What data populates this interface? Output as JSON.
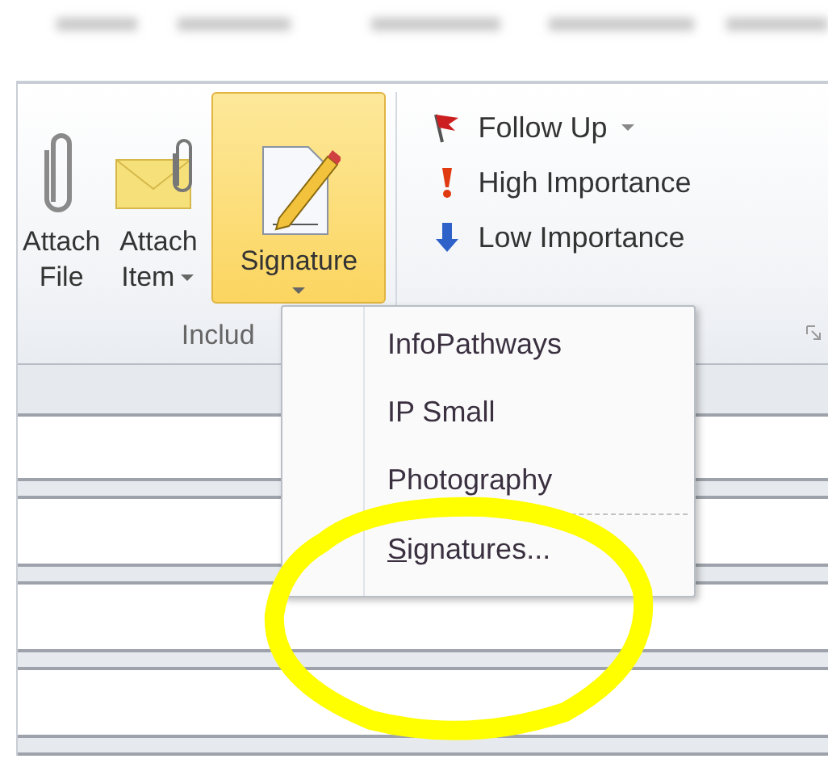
{
  "ribbon": {
    "groups": [
      {
        "label": "Includ",
        "buttons": [
          {
            "kind": "paperclip",
            "lines": [
              "Attach",
              "File"
            ],
            "dropdown": false,
            "selected": false
          },
          {
            "kind": "envelope",
            "lines": [
              "Attach",
              "Item"
            ],
            "dropdown": true,
            "selected": false
          },
          {
            "kind": "signature",
            "lines": [
              "Signature"
            ],
            "dropdown": true,
            "selected": true
          }
        ]
      },
      {
        "commands": [
          {
            "kind": "flag",
            "label": "Follow Up",
            "dropdown": true
          },
          {
            "kind": "high",
            "label": "High Importance",
            "dropdown": false
          },
          {
            "kind": "low",
            "label": "Low Importance",
            "dropdown": false
          }
        ]
      }
    ]
  },
  "signature_menu": {
    "items": [
      {
        "label": "InfoPathways",
        "separator_before": false,
        "mnemonic_first": false
      },
      {
        "label": "IP Small",
        "separator_before": false,
        "mnemonic_first": false
      },
      {
        "label": "Photography",
        "separator_before": false,
        "mnemonic_first": false
      },
      {
        "label": "Signatures...",
        "separator_before": true,
        "mnemonic_first": true
      }
    ]
  }
}
